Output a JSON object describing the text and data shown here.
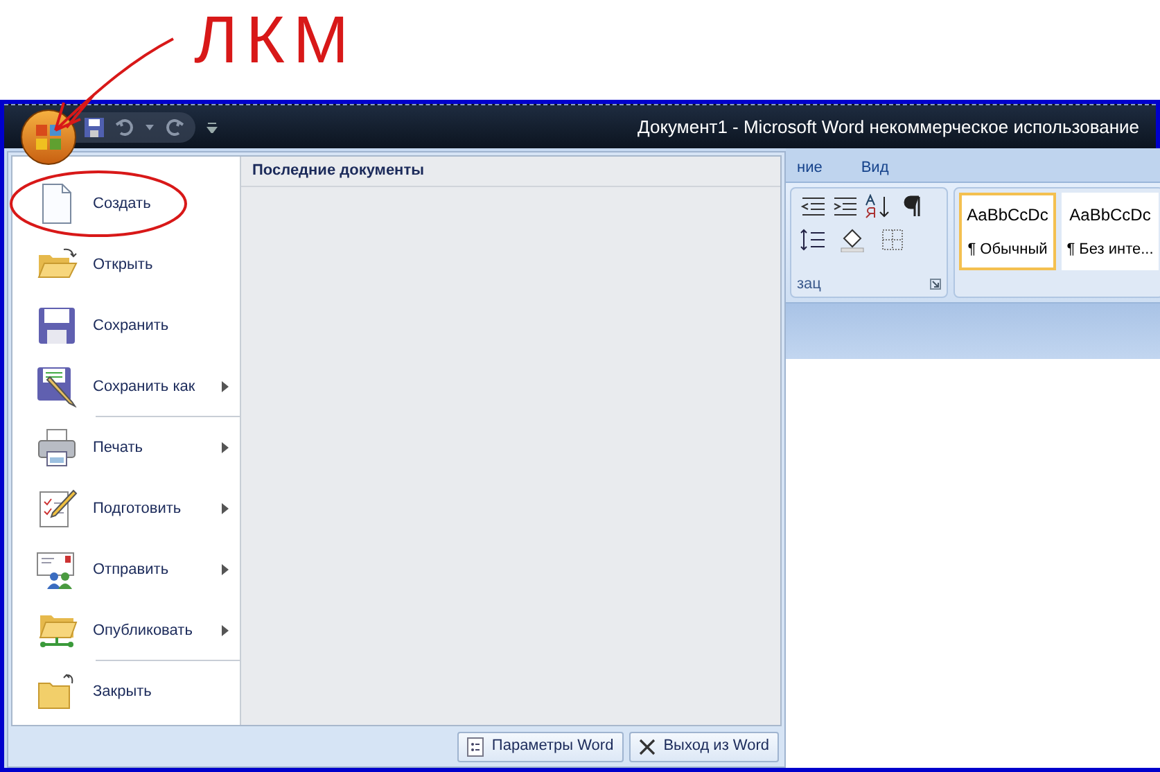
{
  "annotation": {
    "text": "ЛКМ"
  },
  "window": {
    "title": "Документ1 - Microsoft Word некоммерческое использование"
  },
  "office_menu": {
    "items": [
      {
        "label": "Создать",
        "submenu": false,
        "separator_after": false,
        "circled": true
      },
      {
        "label": "Открыть",
        "submenu": false,
        "separator_after": false,
        "circled": false
      },
      {
        "label": "Сохранить",
        "submenu": false,
        "separator_after": false,
        "circled": false
      },
      {
        "label": "Сохранить как",
        "submenu": true,
        "separator_after": true,
        "circled": false
      },
      {
        "label": "Печать",
        "submenu": true,
        "separator_after": false,
        "circled": false
      },
      {
        "label": "Подготовить",
        "submenu": true,
        "separator_after": false,
        "circled": false
      },
      {
        "label": "Отправить",
        "submenu": true,
        "separator_after": false,
        "circled": false
      },
      {
        "label": "Опубликовать",
        "submenu": true,
        "separator_after": true,
        "circled": false
      },
      {
        "label": "Закрыть",
        "submenu": false,
        "separator_after": false,
        "circled": false
      }
    ],
    "recent_heading": "Последние документы",
    "buttons": [
      "Параметры Word",
      "Выход из Word"
    ]
  },
  "ribbon": {
    "tabs": [
      "ние",
      "Вид"
    ],
    "group_label": "зац",
    "styles": [
      {
        "preview": "AaBbCcDc",
        "name": "¶ Обычный",
        "selected": true
      },
      {
        "preview": "AaBbCcDc",
        "name": "¶ Без инте...",
        "selected": false
      }
    ]
  }
}
